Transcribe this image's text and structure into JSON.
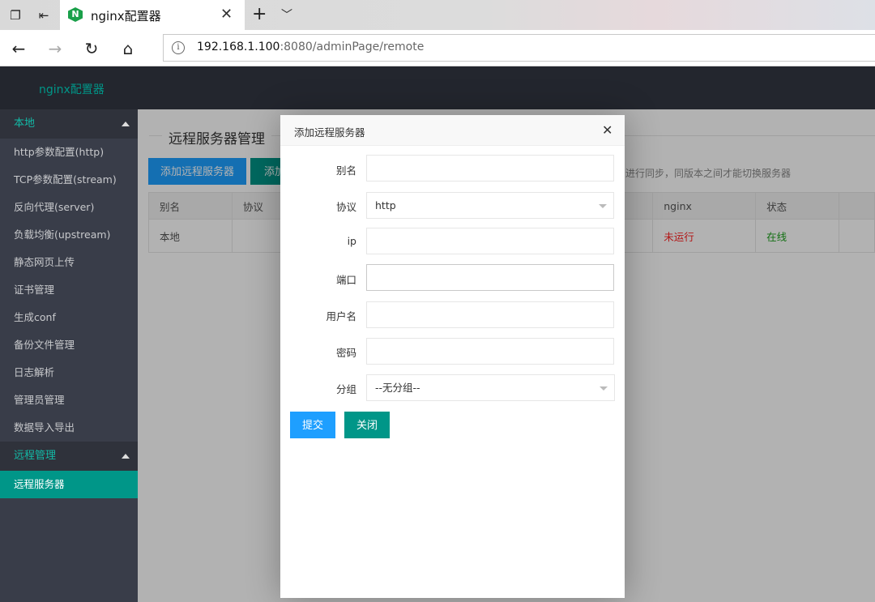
{
  "browser": {
    "tab_title": "nginx配置器",
    "tab_logo_letter": "N",
    "new_tab": "+",
    "close": "✕",
    "url_host": "192.168.1.100",
    "url_rest": ":8080/adminPage/remote",
    "info": "i"
  },
  "app": {
    "logo": "nginx配置器"
  },
  "sidebar": {
    "group_local": "本地",
    "local_items": [
      {
        "label": "http参数配置(http)"
      },
      {
        "label": "TCP参数配置(stream)"
      },
      {
        "label": "反向代理(server)"
      },
      {
        "label": "负载均衡(upstream)"
      },
      {
        "label": "静态网页上传"
      },
      {
        "label": "证书管理"
      },
      {
        "label": "生成conf"
      },
      {
        "label": "备份文件管理"
      },
      {
        "label": "日志解析"
      },
      {
        "label": "管理员管理"
      },
      {
        "label": "数据导入导出"
      }
    ],
    "group_remote": "远程管理",
    "remote_items": [
      {
        "label": "远程服务器",
        "active": true
      }
    ]
  },
  "main": {
    "title": "远程服务器管理",
    "add_remote_btn": "添加远程服务器",
    "add_group_btn_partial": "添加",
    "hint_partial": "进行同步，同版本之间才能切换服务器",
    "table": {
      "headers": [
        "别名",
        "协议",
        "nginx",
        "状态"
      ],
      "row": {
        "alias": "本地",
        "protocol": "",
        "nginx": "未运行",
        "status": "在线"
      }
    }
  },
  "modal": {
    "title": "添加远程服务器",
    "close": "✕",
    "fields": {
      "alias_label": "别名",
      "alias_value": "",
      "protocol_label": "协议",
      "protocol_value": "http",
      "ip_label": "ip",
      "ip_value": "",
      "port_label": "端口",
      "port_value": "",
      "username_label": "用户名",
      "username_value": "",
      "password_label": "密码",
      "password_value": "",
      "group_label": "分组",
      "group_value": "--无分组--"
    },
    "submit_btn": "提交",
    "close_btn": "关闭"
  },
  "colors": {
    "accent_green": "#009688",
    "accent_blue": "#1e9fff",
    "sidebar_bg": "#393d49",
    "header_bg": "#23262e",
    "status_offline": "#ff2222",
    "status_online": "#1aa01a"
  }
}
